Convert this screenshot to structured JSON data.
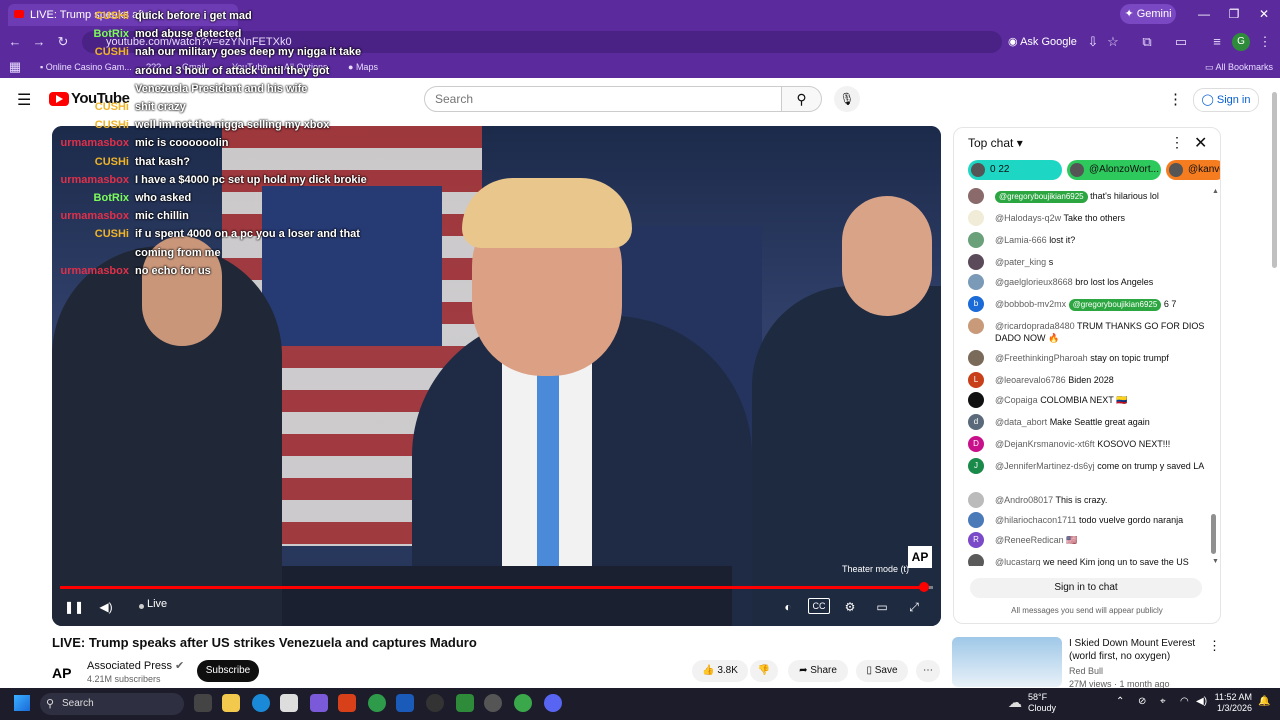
{
  "browser": {
    "tab_title": "LIVE: Trump speaks afte…",
    "url": "youtube.com/watch?v=ezYNnFETXk0",
    "gemini_label": "Gemini",
    "ask_google": "Ask Google",
    "profile_initial": "G",
    "bookmarks": [
      "Online Casino Gam...",
      "???",
      "Gmail",
      "YouTube",
      "All Options",
      "Maps"
    ],
    "all_bookmarks": "All Bookmarks"
  },
  "youtube": {
    "logo_text": "YouTube",
    "search_placeholder": "Search",
    "sign_in": "Sign in"
  },
  "overlay_chat": [
    {
      "user": "CUSHi",
      "color": "#f0b429",
      "message": "quick before i get mad"
    },
    {
      "user": "BotRix",
      "color": "#7cfc5a",
      "message": "mod abuse detected"
    },
    {
      "user": "CUSHi",
      "color": "#f0b429",
      "message": "nah our military goes deep my nigga it take"
    },
    {
      "user": "",
      "color": "#f0b429",
      "message": "around 3 hour of attack until they got"
    },
    {
      "user": "",
      "color": "#f0b429",
      "message": "Venezuela President and his wife"
    },
    {
      "user": "CUSHi",
      "color": "#f0b429",
      "message": "shit crazy"
    },
    {
      "user": "CUSHi",
      "color": "#f0b429",
      "message": "well im not the nigga selling my xbox"
    },
    {
      "user": "urmamasbox",
      "color": "#e0304a",
      "message": "mic is coooooolin"
    },
    {
      "user": "CUSHi",
      "color": "#f0b429",
      "message": "that kash?"
    },
    {
      "user": "urmamasbox",
      "color": "#e0304a",
      "message": "I have a $4000 pc set up hold my dick brokie"
    },
    {
      "user": "BotRix",
      "color": "#7cfc5a",
      "message": "who asked"
    },
    {
      "user": "urmamasbox",
      "color": "#e0304a",
      "message": "mic chillin"
    },
    {
      "user": "CUSHi",
      "color": "#f0b429",
      "message": "if u spent 4000 on a pc you a loser and that"
    },
    {
      "user": "",
      "color": "#f0b429",
      "message": "coming from me"
    },
    {
      "user": "urmamasbox",
      "color": "#e0304a",
      "message": "no echo for us"
    }
  ],
  "player": {
    "live_label": "Live",
    "theater_tooltip": "Theater mode (t)",
    "watermark": "AP",
    "progress": 0.99
  },
  "video": {
    "title": "LIVE: Trump speaks after US strikes Venezuela and captures Maduro",
    "channel": "Associated Press",
    "subscribers": "4.21M subscribers",
    "subscribe_label": "Subscribe",
    "likes": "3.8K",
    "share_label": "Share",
    "save_label": "Save",
    "channel_avatar_text": "AP"
  },
  "chat": {
    "header": "Top chat",
    "pills": [
      {
        "label": "0   22",
        "color": "#1ed6c4"
      },
      {
        "label": "@AlonzoWort...",
        "color": "#2ec95c"
      },
      {
        "label": "@kanvo",
        "color": "#f57c1f"
      }
    ],
    "messages": [
      {
        "author": "",
        "text": "that's hilarious lol",
        "mention": "@gregoryboujikian6925",
        "avatar": "",
        "avatar_color": "#8a6a6a"
      },
      {
        "author": "@Halodays-q2w",
        "text": "Take tho others",
        "mention": "",
        "avatar": "",
        "avatar_color": "#f1ecd8"
      },
      {
        "author": "@Lamia-666",
        "text": "lost it?",
        "mention": "",
        "avatar": "",
        "avatar_color": "#6aa07a"
      },
      {
        "author": "@pater_king",
        "text": "s",
        "mention": "",
        "avatar": "",
        "avatar_color": "#5a4a5a"
      },
      {
        "author": "@gaelglorieux8668",
        "text": "bro lost los Angeles",
        "mention": "",
        "avatar": "",
        "avatar_color": "#7a9ab8"
      },
      {
        "author": "@bobbob-mv2mx",
        "text": "6 7",
        "mention": "@gregoryboujikian6925",
        "avatar": "b",
        "avatar_color": "#1a6ad8"
      },
      {
        "author": "@ricardoprada8480",
        "text": "TRUM THANKS GO FOR DIOS DADO NOW 🔥",
        "mention": "",
        "avatar": "",
        "avatar_color": "#c89a7a"
      },
      {
        "author": "@FreethinkingPharoah",
        "text": "stay on topic trumpf",
        "mention": "",
        "avatar": "",
        "avatar_color": "#7a6a5a"
      },
      {
        "author": "@leoarevalo6786",
        "text": "Biden 2028",
        "mention": "",
        "avatar": "L",
        "avatar_color": "#c8401a"
      },
      {
        "author": "@Copaiga",
        "text": "COLOMBIA NEXT 🇨🇴",
        "mention": "",
        "avatar": "",
        "avatar_color": "#111111"
      },
      {
        "author": "@data_abort",
        "text": "Make Seattle great again",
        "mention": "",
        "avatar": "d",
        "avatar_color": "#5a6a7a"
      },
      {
        "author": "@DejanKrsmanovic-xt6ft",
        "text": "KOSOVO NEXT!!!",
        "mention": "",
        "avatar": "D",
        "avatar_color": "#c8108a"
      },
      {
        "author": "@JenniferMartinez-ds6yj",
        "text": "come on trump y saved LA",
        "mention": "",
        "avatar": "J",
        "avatar_color": "#1a8a4a"
      },
      {
        "author": "@Andro08017",
        "text": "This is crazy.",
        "mention": "",
        "avatar": "",
        "avatar_color": "#bbbbbb"
      },
      {
        "author": "@hilariochacon1711",
        "text": "todo vuelve gordo naranja",
        "mention": "",
        "avatar": "",
        "avatar_color": "#4a7ab8"
      },
      {
        "author": "@ReneeRedican",
        "text": "🇺🇸",
        "mention": "",
        "avatar": "R",
        "avatar_color": "#7a4ac8"
      },
      {
        "author": "@lucastarg",
        "text": "we need Kim jong un to save the US",
        "mention": "",
        "avatar": "",
        "avatar_color": "#5a5a5a"
      }
    ],
    "sign_in_label": "Sign in to chat",
    "footnote": "All messages you send will appear publicly"
  },
  "recommendation": {
    "title": "I Skied Down Mount Everest (world first, no oxygen)",
    "channel": "Red Bull",
    "meta": "27M views · 1 month ago"
  },
  "taskbar": {
    "search_placeholder": "Search",
    "temperature": "58°F",
    "condition": "Cloudy",
    "time": "11:52 AM",
    "date": "1/3/2026"
  }
}
